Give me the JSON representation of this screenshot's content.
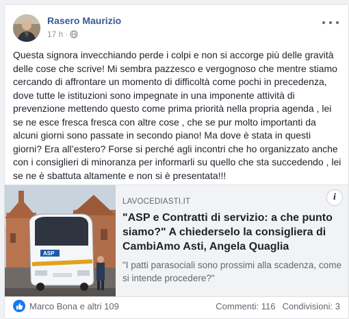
{
  "post": {
    "author": "Rasero Maurizio",
    "time": "17 h",
    "separator": "·",
    "privacy_icon": "globe-icon",
    "text": "Questa signora invecchiando perde i colpi e non si accorge più delle gravità delle cose che scrive! Mi sembra pazzesco e vergognoso che mentre stiamo cercando di affrontare un momento di difficoltà come pochi in precedenza, dove tutte le istituzioni sono impegnate in una imponente attività di prevenzione mettendo questo come prima priorità nella propria agenda , lei se ne esce fresca fresca con altre cose , che se pur molto importanti da alcuni giorni sono passate in secondo piano! Ma dove è stata in questi giorni? Era all’estero? Forse si perché agli incontri che ho organizzato anche con i consiglieri di minoranza per informarli su quello che sta succedendo , lei se ne è sbattuta altamente e non si è presentata!!!"
  },
  "link": {
    "domain": "LAVOCEDIASTI.IT",
    "title": "\"ASP e Contratti di servizio: a che punto siamo?\" A chiederselo la consigliera di CambiAmo Asti, Angela Quaglia",
    "description": "\"I patti parasociali sono prossimi alla scadenza, come si intende procedere?\"",
    "bus_logo": "ASP",
    "info_label": "i"
  },
  "footer": {
    "reactors": "Marco Bona e altri 109",
    "comments": "Commenti: 116",
    "shares": "Condivisioni: 3"
  },
  "colors": {
    "author_link": "#385898",
    "like_blue": "#1877f2",
    "text": "#1d2129",
    "muted": "#606770"
  }
}
